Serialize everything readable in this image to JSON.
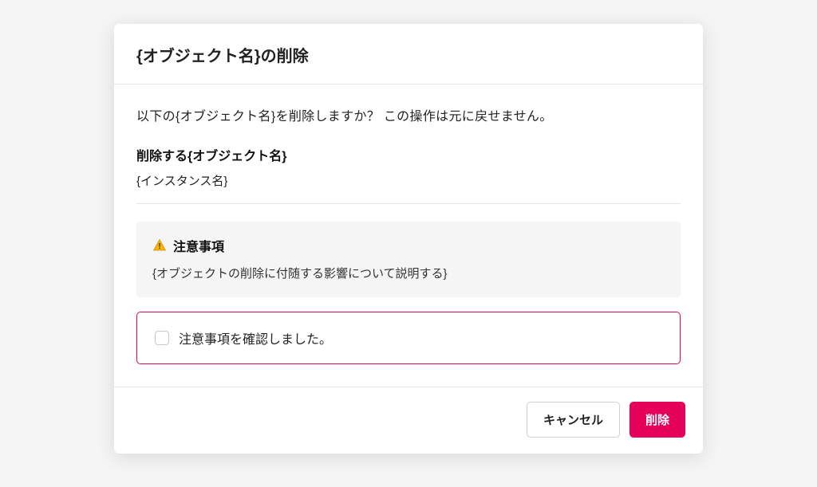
{
  "dialog": {
    "title": "{オブジェクト名}の削除",
    "intro": "以下の{オブジェクト名}を削除しますか？ この操作は元に戻せません。",
    "subject_label": "削除する{オブジェクト名}",
    "instance_name": "{インスタンス名}",
    "notice": {
      "title": "注意事項",
      "body": "{オブジェクトの削除に付随する影響について説明する}"
    },
    "confirm_label": "注意事項を確認しました。",
    "footer": {
      "cancel_label": "キャンセル",
      "delete_label": "削除"
    }
  },
  "colors": {
    "danger": "#e5005a",
    "warning_fill": "#f7b500",
    "warning_stroke": "#d29400"
  }
}
